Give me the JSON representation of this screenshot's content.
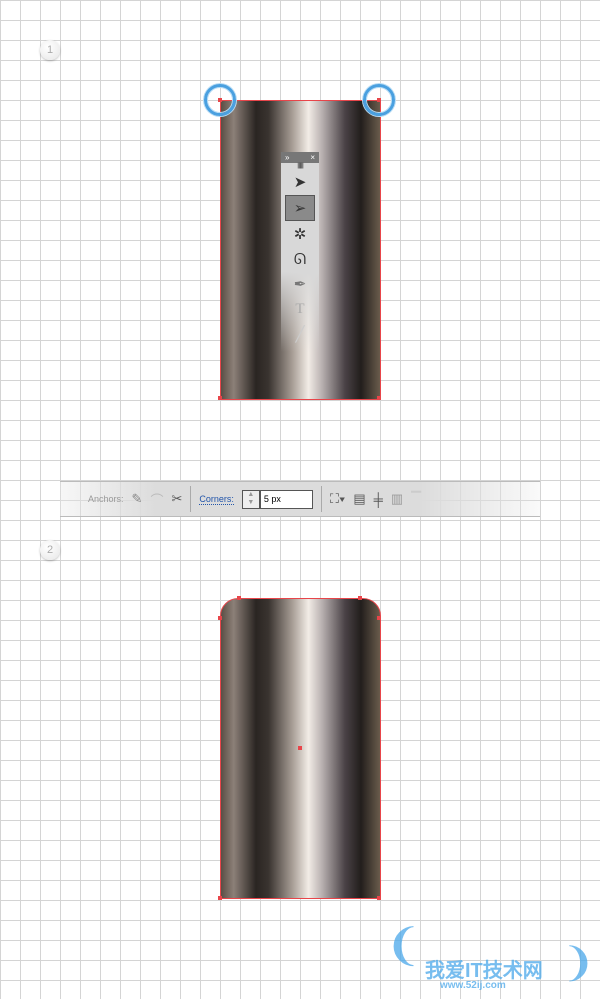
{
  "steps": [
    "1",
    "2"
  ],
  "tools_panel": {
    "header_left": "»",
    "header_right": "×",
    "grip": "||||||||||"
  },
  "toolbar": {
    "anchors_label": "Anchors:",
    "corners_label": "Corners:",
    "corners_value": "5 px",
    "stepper_up": "▲",
    "stepper_down": "▼"
  },
  "watermark": {
    "title": "我爱IT技术网",
    "url": "www.52ij.com"
  },
  "colors": {
    "path": "#e8454a",
    "highlight": "#4aa0e0"
  }
}
